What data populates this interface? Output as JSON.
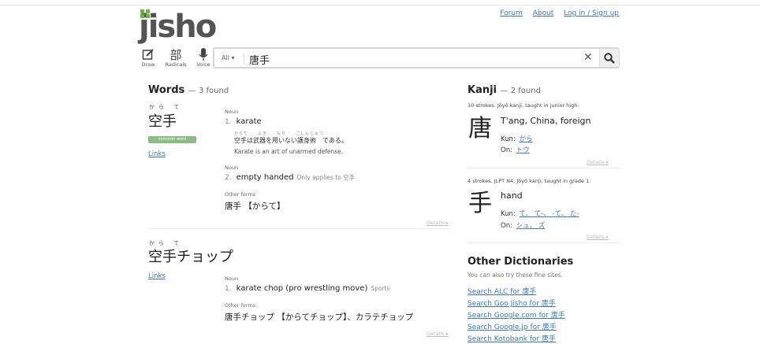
{
  "logo": {
    "text": "jisho"
  },
  "topnav": {
    "forum": "Forum",
    "about": "About",
    "login": "Log in / Sign up"
  },
  "tools": {
    "draw": "Draw",
    "radicals_icon": "部",
    "radicals": "Radicals",
    "voice": "Voice"
  },
  "search": {
    "scope": "All ▾",
    "value": "唐手"
  },
  "words": {
    "heading": "Words",
    "count": "— 3 found",
    "entries": [
      {
        "furigana": "から て",
        "word": "空手",
        "badge": "common word",
        "links": "Links",
        "senses": [
          {
            "pos": "Noun",
            "num": "1.",
            "meaning": "karate",
            "ex_furigana": "からて　　ぶき　　もち　　ごしんじゅつ",
            "ex_ja": "空手は武器を用いない護身術　である。",
            "ex_en": "Karate is an art of unarmed defense."
          },
          {
            "pos": "Noun",
            "num": "2.",
            "meaning": "empty handed",
            "note": "Only applies to 空手"
          }
        ],
        "other_forms_label": "Other forms",
        "other_forms": "唐手 【からて】",
        "details": "Details ▸"
      },
      {
        "furigana": "から て",
        "word": "空手チョップ",
        "links": "Links",
        "senses": [
          {
            "pos": "Noun",
            "num": "1.",
            "meaning": "karate chop (pro wrestling move)",
            "tag": "Sports"
          }
        ],
        "other_forms_label": "Other forms",
        "other_forms": "唐手チョップ 【からてチョップ】、カラテチョップ",
        "details": "Details ▸"
      }
    ]
  },
  "kanji": {
    "heading": "Kanji",
    "count": "— 2 found",
    "items": [
      {
        "meta": "10 strokes. Jōyō kanji, taught in junior high.",
        "char": "唐",
        "meaning": "T'ang, China, foreign",
        "kun_label": "Kun:",
        "kun": "から",
        "on_label": "On:",
        "on": "トウ",
        "details": "Details ▸"
      },
      {
        "meta": "4 strokes. JLPT N4. Jōyō kanji, taught in grade 1.",
        "char": "手",
        "meaning": "hand",
        "kun_label": "Kun:",
        "kun": "て、 て-、 -て、 た-",
        "on_label": "On:",
        "on": "シュ、 ズ",
        "details": "Details ▸"
      }
    ]
  },
  "dictionaries": {
    "heading": "Other Dictionaries",
    "sub": "You can also try these fine sites.",
    "links": [
      "Search ALC for 唐手",
      "Search Goo Jisho for 唐手",
      "Search Google.com for 唐手",
      "Search Google.jp for 唐手",
      "Search Kotobank for 唐手"
    ]
  },
  "colors": {
    "accent": "#6cb33f",
    "link": "#3a7ab7",
    "badge": "#8abc83"
  }
}
